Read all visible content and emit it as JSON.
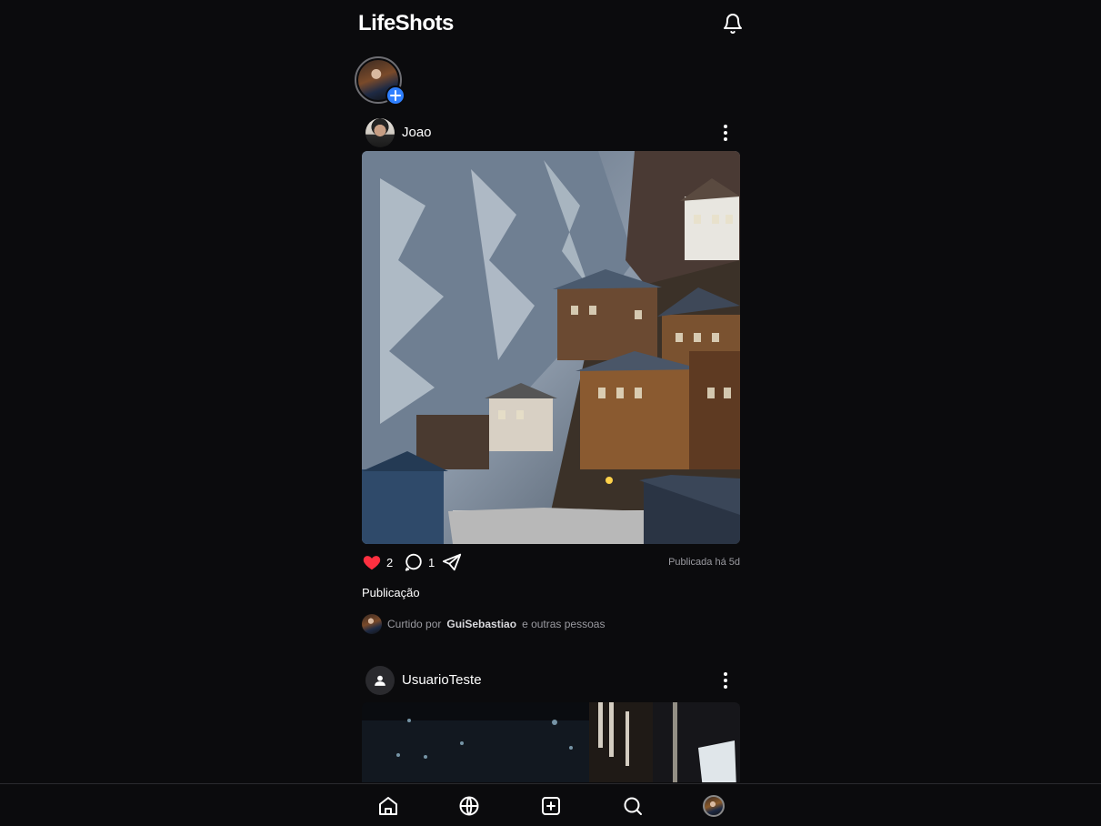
{
  "app": {
    "title": "LifeShots"
  },
  "posts": [
    {
      "username": "Joao",
      "likes": "2",
      "comments": "1",
      "published": "Publicada há 5d",
      "caption": "Publicação",
      "liked_prefix": "Curtido por",
      "liked_user": "GuiSebastiao",
      "liked_suffix": "e outras pessoas"
    },
    {
      "username": "UsuarioTeste"
    }
  ],
  "nav": {
    "items": [
      "home-icon",
      "globe-icon",
      "add-post-icon",
      "search-icon",
      "profile-avatar"
    ]
  },
  "colors": {
    "background": "#0b0b0d",
    "accent": "#2f80ff",
    "like": "#ff3040"
  }
}
